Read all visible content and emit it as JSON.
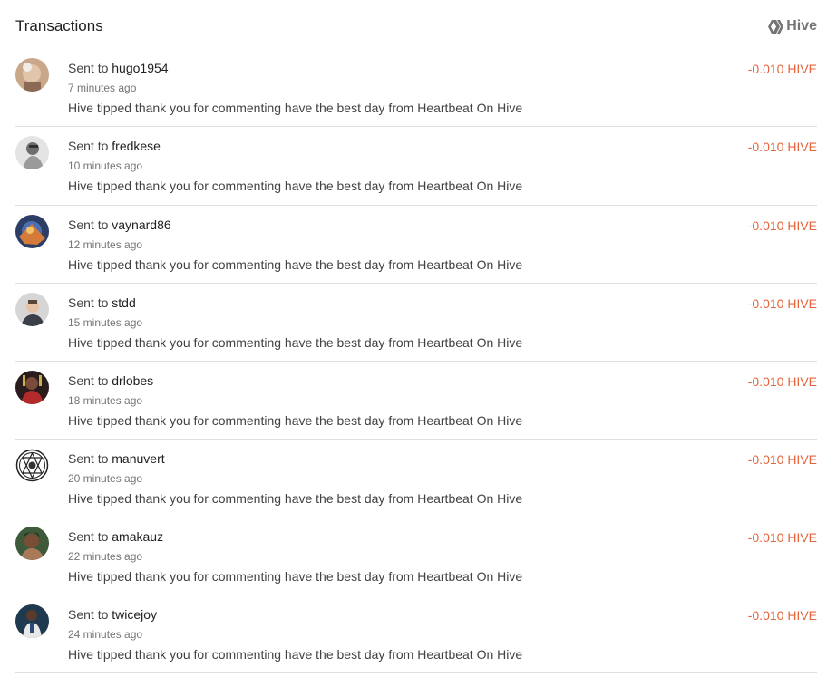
{
  "header": {
    "title": "Transactions",
    "brand_label": "Hive",
    "brand_icon": "hive-logo-icon"
  },
  "colors": {
    "amount": "#e6643c",
    "divider": "#e0e0e0",
    "muted": "#757575"
  },
  "transactions": [
    {
      "prefix": "Sent to",
      "user": "hugo1954",
      "time": "7 minutes ago",
      "memo": "Hive tipped thank you for commenting have the best day from Heartbeat On Hive",
      "amount": "-0.010 HIVE"
    },
    {
      "prefix": "Sent to",
      "user": "fredkese",
      "time": "10 minutes ago",
      "memo": "Hive tipped thank you for commenting have the best day from Heartbeat On Hive",
      "amount": "-0.010 HIVE"
    },
    {
      "prefix": "Sent to",
      "user": "vaynard86",
      "time": "12 minutes ago",
      "memo": "Hive tipped thank you for commenting have the best day from Heartbeat On Hive",
      "amount": "-0.010 HIVE"
    },
    {
      "prefix": "Sent to",
      "user": "stdd",
      "time": "15 minutes ago",
      "memo": "Hive tipped thank you for commenting have the best day from Heartbeat On Hive",
      "amount": "-0.010 HIVE"
    },
    {
      "prefix": "Sent to",
      "user": "drlobes",
      "time": "18 minutes ago",
      "memo": "Hive tipped thank you for commenting have the best day from Heartbeat On Hive",
      "amount": "-0.010 HIVE"
    },
    {
      "prefix": "Sent to",
      "user": "manuvert",
      "time": "20 minutes ago",
      "memo": "Hive tipped thank you for commenting have the best day from Heartbeat On Hive",
      "amount": "-0.010 HIVE"
    },
    {
      "prefix": "Sent to",
      "user": "amakauz",
      "time": "22 minutes ago",
      "memo": "Hive tipped thank you for commenting have the best day from Heartbeat On Hive",
      "amount": "-0.010 HIVE"
    },
    {
      "prefix": "Sent to",
      "user": "twicejoy",
      "time": "24 minutes ago",
      "memo": "Hive tipped thank you for commenting have the best day from Heartbeat On Hive",
      "amount": "-0.010 HIVE"
    }
  ]
}
